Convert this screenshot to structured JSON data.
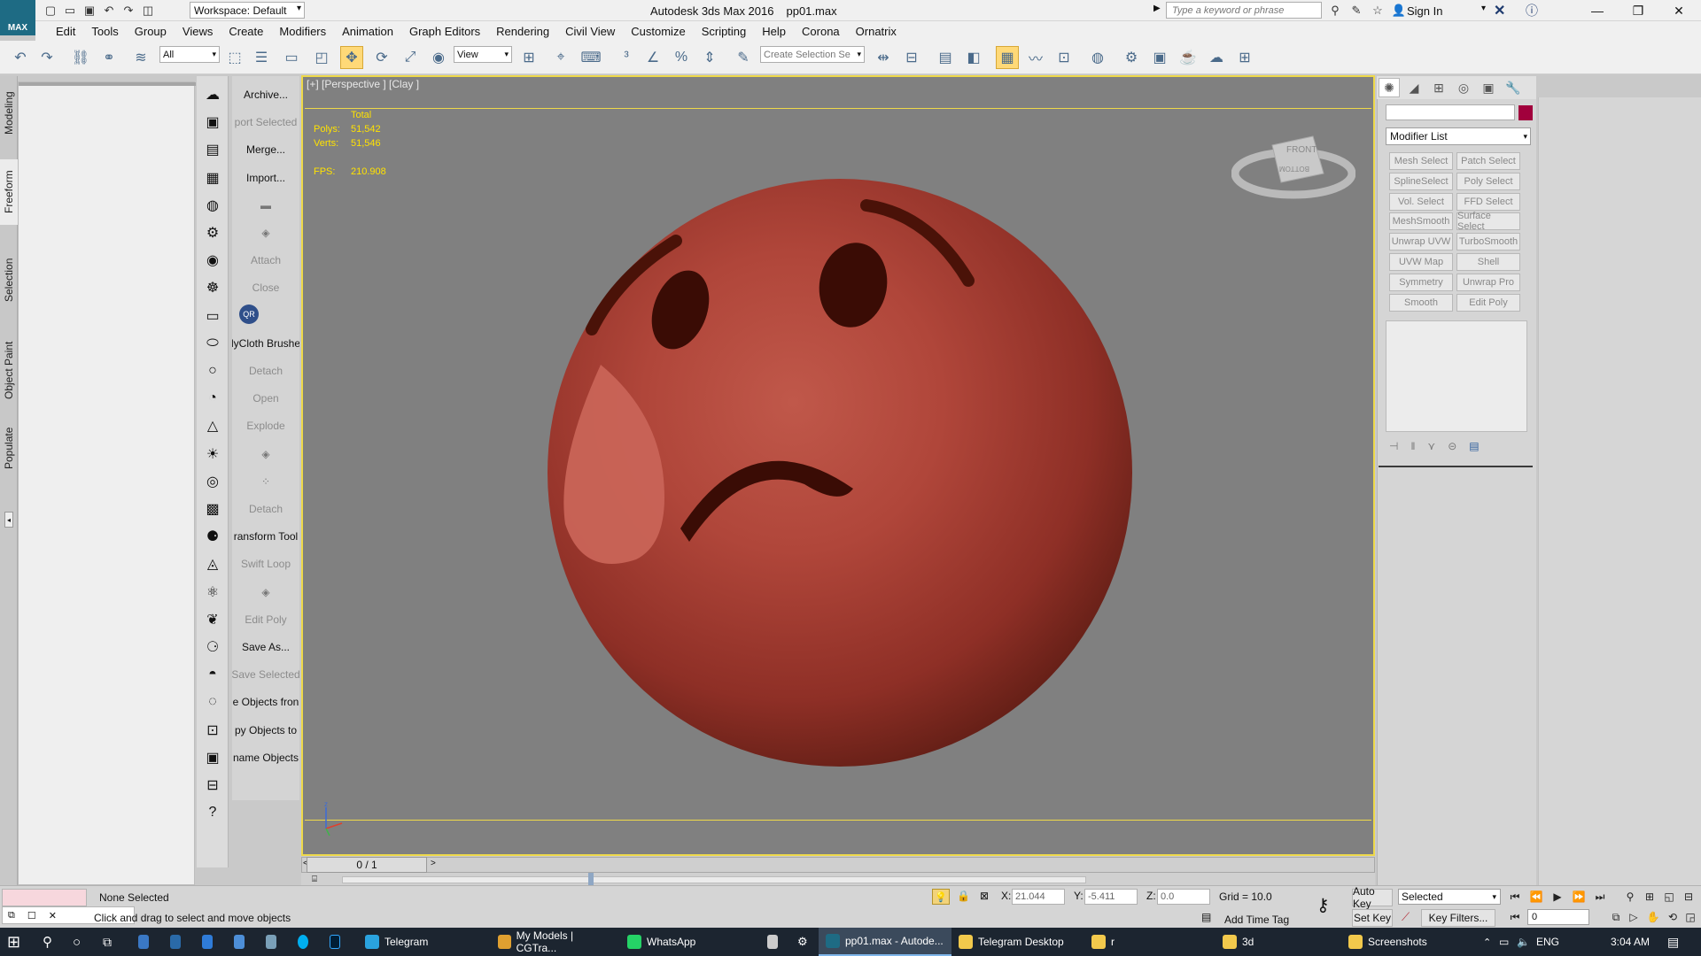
{
  "app": {
    "logo": "MAX",
    "title": "Autodesk 3ds Max 2016",
    "file": "pp01.max",
    "workspace": "Workspace: Default",
    "search_placeholder": "Type a keyword or phrase",
    "sign_in": "Sign In"
  },
  "menu": [
    "Edit",
    "Tools",
    "Group",
    "Views",
    "Create",
    "Modifiers",
    "Animation",
    "Graph Editors",
    "Rendering",
    "Civil View",
    "Customize",
    "Scripting",
    "Help",
    "Corona",
    "Ornatrix"
  ],
  "toolbar": {
    "filter_value": "All",
    "refcoord_value": "View",
    "named_selection_placeholder": "Create Selection Se"
  },
  "ribbon_tabs": [
    "Modeling",
    "Freeform",
    "Selection",
    "Object Paint",
    "Populate"
  ],
  "command_labels": [
    {
      "text": "Archive...",
      "dim": false
    },
    {
      "text": "port Selected",
      "dim": true
    },
    {
      "text": "Merge...",
      "dim": false
    },
    {
      "text": "Import...",
      "dim": false
    },
    {
      "text": "",
      "dim": false
    },
    {
      "text": "",
      "dim": false
    },
    {
      "text": "Attach",
      "dim": true
    },
    {
      "text": "Close",
      "dim": true
    },
    {
      "text": "",
      "dim": false
    },
    {
      "text": "lyCloth Brushe",
      "dim": false
    },
    {
      "text": "Detach",
      "dim": true
    },
    {
      "text": "Open",
      "dim": true
    },
    {
      "text": "Explode",
      "dim": true
    },
    {
      "text": "",
      "dim": false
    },
    {
      "text": "",
      "dim": false
    },
    {
      "text": "Detach",
      "dim": true
    },
    {
      "text": "ransform Tool",
      "dim": false
    },
    {
      "text": "Swift Loop",
      "dim": true
    },
    {
      "text": "",
      "dim": false
    },
    {
      "text": "Edit Poly",
      "dim": true
    },
    {
      "text": "Save As...",
      "dim": false
    },
    {
      "text": "Save Selected",
      "dim": true
    },
    {
      "text": "e Objects fron",
      "dim": false
    },
    {
      "text": "py Objects to",
      "dim": false
    },
    {
      "text": "name Objects",
      "dim": false
    }
  ],
  "viewport": {
    "label": "[+] [Perspective ] [Clay ]",
    "stats_header": "Total",
    "polys_label": "Polys:",
    "polys_value": "51,542",
    "verts_label": "Verts:",
    "verts_value": "51,546",
    "fps_label": "FPS:",
    "fps_value": "210.908",
    "viewcube_front": "FRONT",
    "viewcube_bottom": "BOTTOM",
    "axis_z": "z"
  },
  "timeline": {
    "frame": "0 / 1"
  },
  "command_panel": {
    "modifier_list": "Modifier List",
    "buttons": [
      "Mesh Select",
      "Patch Select",
      "SplineSelect",
      "Poly Select",
      "Vol. Select",
      "FFD Select",
      "MeshSmooth",
      "Surface Select",
      "Unwrap UVW",
      "TurboSmooth",
      "UVW Map",
      "Shell",
      "Symmetry",
      "Unwrap Pro",
      "Smooth",
      "Edit Poly"
    ],
    "object_color": "#a1003c"
  },
  "status": {
    "selection": "None Selected",
    "prompt": "Click and drag to select and move objects",
    "x_label": "X:",
    "x_value": "21.044",
    "y_label": "Y:",
    "y_value": "-5.411",
    "z_label": "Z:",
    "z_value": "0.0",
    "grid": "Grid = 10.0",
    "add_time_tag": "Add Time Tag",
    "auto_key": "Auto Key",
    "set_key": "Set Key",
    "selected": "Selected",
    "key_filters": "Key Filters...",
    "frame_value": "0"
  },
  "taskbar": {
    "apps": [
      {
        "label": "Telegram",
        "color": "#2aa3df",
        "active": false
      },
      {
        "label": "My Models | CGTra...",
        "color": "#e0a030",
        "active": false
      },
      {
        "label": "WhatsApp",
        "color": "#25d366",
        "active": false
      },
      {
        "label": "pp01.max - Autode...",
        "color": "#1e6b84",
        "active": true
      },
      {
        "label": "Telegram Desktop",
        "color": "#f2c94c",
        "active": false
      },
      {
        "label": "r",
        "color": "#f2c94c",
        "active": false
      },
      {
        "label": "3d",
        "color": "#f2c94c",
        "active": false
      },
      {
        "label": "Screenshots",
        "color": "#f2c94c",
        "active": false
      }
    ],
    "language": "ENG",
    "time": "3:04 AM"
  }
}
